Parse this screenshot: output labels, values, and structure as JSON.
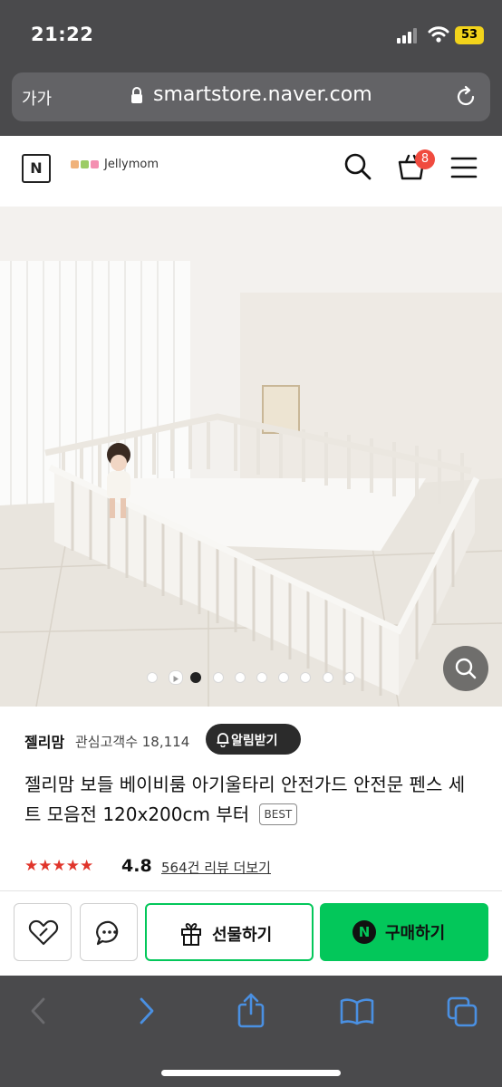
{
  "status": {
    "time": "21:22",
    "battery": "53"
  },
  "browser": {
    "text_size": "가가",
    "url": "smartstore.naver.com"
  },
  "store_header": {
    "naver_logo": "N",
    "brand": "Jellymom",
    "cart_count": "8"
  },
  "gallery": {
    "total_dots": 9,
    "active_index": 1
  },
  "product": {
    "store_name": "젤리맘",
    "interest_label": "관심고객수 18,114",
    "notify_label": "알림받기",
    "title": "젤리맘 보들 베이비룸 아기울타리 안전가드 안전문 펜스 세트 모음전 120x200cm 부터",
    "badge": "BEST",
    "stars": "★★★★★",
    "rating": "4.8",
    "reviews_label": "564건 리뷰 더보기"
  },
  "actions": {
    "gift_label": "선물하기",
    "buy_label": "구매하기",
    "buy_icon": "N"
  },
  "colors": {
    "naver_green": "#03c75a",
    "badge_red": "#f04b3f",
    "star_red": "#e0342a",
    "safari_blue": "#4a90e2"
  },
  "icons": [
    "search-icon",
    "cart-icon",
    "menu-icon",
    "zoom-icon",
    "bell-plus-icon",
    "heart-icon",
    "chat-icon",
    "gift-icon",
    "back-icon",
    "forward-icon",
    "share-icon",
    "bookmarks-icon",
    "tabs-icon",
    "lock-icon",
    "reload-icon"
  ]
}
